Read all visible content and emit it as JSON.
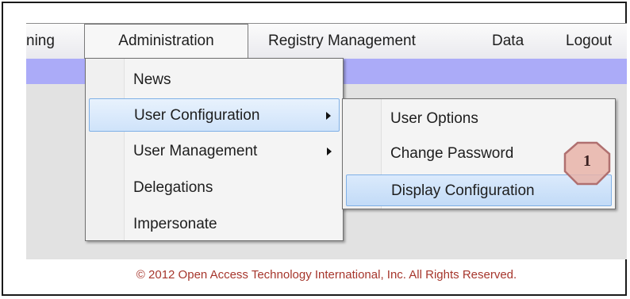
{
  "menubar": {
    "items": [
      {
        "label": "ning"
      },
      {
        "label": "Administration"
      },
      {
        "label": "Registry Management"
      },
      {
        "label": "Data"
      },
      {
        "label": "Logout"
      }
    ]
  },
  "dropdown": {
    "items": [
      {
        "label": "News"
      },
      {
        "label": "User Configuration"
      },
      {
        "label": "User Management"
      },
      {
        "label": "Delegations"
      },
      {
        "label": "Impersonate"
      }
    ]
  },
  "submenu": {
    "items": [
      {
        "label": "User Options"
      },
      {
        "label": "Change Password"
      },
      {
        "label": "Display Configuration"
      }
    ]
  },
  "callout": {
    "number": "1"
  },
  "footer": {
    "copyright": "© 2012 Open Access Technology International, Inc. All Rights Reserved."
  },
  "colors": {
    "band": "#ababf8",
    "highlight": "#cfe3fa",
    "callout_fill": "#e8b3a8",
    "callout_stroke": "#b07070"
  }
}
